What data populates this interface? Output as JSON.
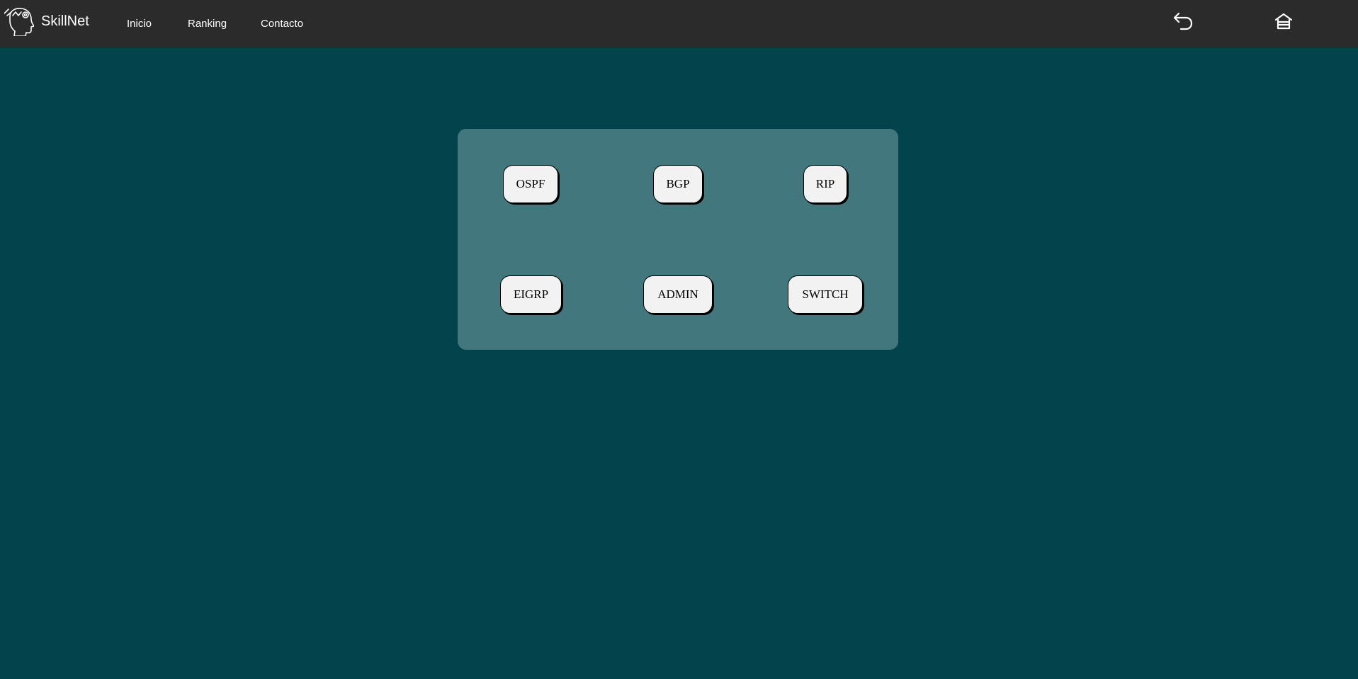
{
  "navbar": {
    "brand_name": "SkillNet",
    "logo_icon": "head-with-gears-icon",
    "links": [
      {
        "label": "Inicio"
      },
      {
        "label": "Ranking"
      },
      {
        "label": "Contacto"
      }
    ],
    "back_icon": "return-arrow-icon",
    "home_icon": "home-icon"
  },
  "topics": [
    {
      "label": "OSPF"
    },
    {
      "label": "BGP"
    },
    {
      "label": "RIP"
    },
    {
      "label": "EIGRP"
    },
    {
      "label": "ADMIN"
    },
    {
      "label": "SWITCH"
    }
  ],
  "colors": {
    "page_background": "#02434c",
    "navbar_background": "#2b2b2b",
    "panel_background": "#41777d",
    "button_background": "#f2f2f2"
  }
}
